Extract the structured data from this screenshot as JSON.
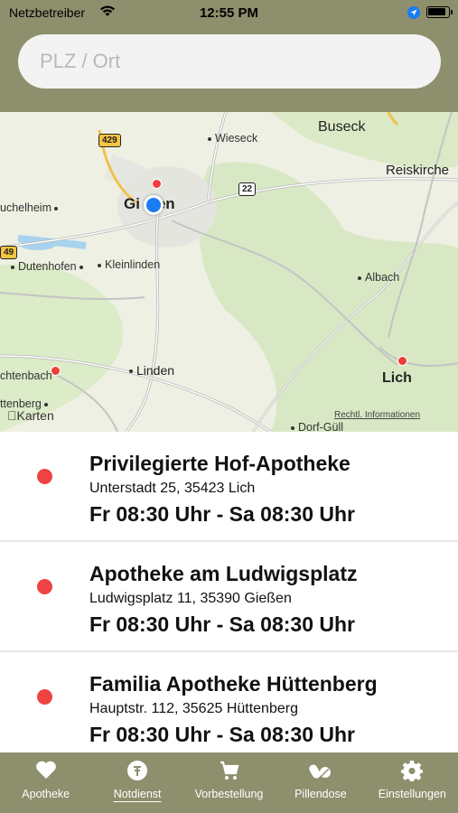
{
  "status_bar": {
    "carrier": "Netzbetreiber",
    "time": "12:55 PM"
  },
  "search": {
    "placeholder": "PLZ / Ort",
    "value": ""
  },
  "map": {
    "labels": {
      "giessen": "Gi    en",
      "buseck": "Buseck",
      "wieseck": "Wieseck",
      "reiskirchen": "Reiskirche",
      "heuchelheim": "uchelheim",
      "dutenhofen": "Dutenhofen",
      "kleinlinden": "Kleinlinden",
      "albach": "Albach",
      "linden": "Linden",
      "lich": "Lich",
      "muschenbach": "chtenbach",
      "huttenberg": "ttenberg",
      "dorf_gull": "Dorf-Güll"
    },
    "road_signs": {
      "b429": "429",
      "b49": "49",
      "a22": "22"
    },
    "attribution": "Karten",
    "legal": "Rechtl. Informationen"
  },
  "pharmacies": [
    {
      "name": "Privilegierte Hof-Apotheke",
      "address": "Unterstadt 25, 35423 Lich",
      "hours": "Fr 08:30 Uhr - Sa 08:30 Uhr"
    },
    {
      "name": "Apotheke am Ludwigsplatz",
      "address": "Ludwigsplatz 11, 35390 Gießen",
      "hours": "Fr 08:30 Uhr - Sa 08:30 Uhr"
    },
    {
      "name": "Familia Apotheke Hüttenberg",
      "address": "Hauptstr. 112, 35625 Hüttenberg",
      "hours": "Fr 08:30 Uhr - Sa 08:30 Uhr"
    }
  ],
  "tabs": [
    {
      "label": "Apotheke",
      "icon": "heart-icon",
      "active": false
    },
    {
      "label": "Notdienst",
      "icon": "emergency-icon",
      "active": true
    },
    {
      "label": "Vorbestellung",
      "icon": "cart-icon",
      "active": false
    },
    {
      "label": "Pillendose",
      "icon": "pills-icon",
      "active": false
    },
    {
      "label": "Einstellungen",
      "icon": "gear-icon",
      "active": false
    }
  ],
  "colors": {
    "header": "#8e8f6c",
    "marker": "#ef4343",
    "user_location": "#1a7cf0"
  }
}
